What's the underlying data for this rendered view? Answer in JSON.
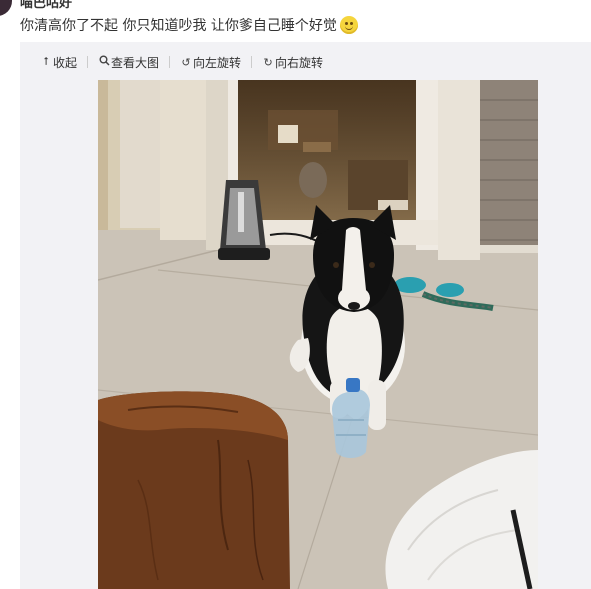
{
  "post": {
    "username": "喵巴咕好",
    "text": "你清高你了不起 你只知道吵我 让你爹自己睡个好觉",
    "emoji_icon": "smile-emoji-icon"
  },
  "toolbar": {
    "collapse_label": "收起",
    "view_large_label": "查看大图",
    "rotate_left_label": "向左旋转",
    "rotate_right_label": "向右旋转"
  },
  "image": {
    "description_icon": "photo-dog-on-floor"
  }
}
